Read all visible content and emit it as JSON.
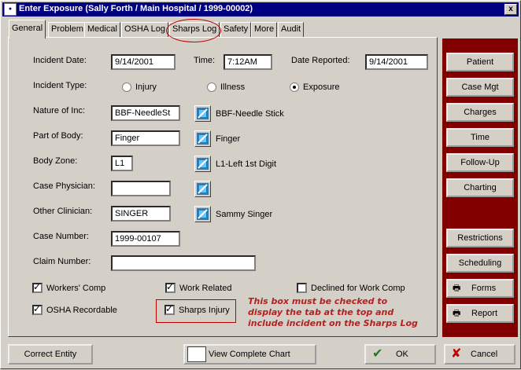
{
  "window": {
    "title": "Enter Exposure (Sally Forth / Main Hospital / 1999-00002)",
    "app_icon": "app-icon",
    "close_label": "x"
  },
  "tabs": [
    {
      "label": "General",
      "active": true
    },
    {
      "label": "Problem"
    },
    {
      "label": "Medical"
    },
    {
      "label": "OSHA Log"
    },
    {
      "label": "Sharps Log"
    },
    {
      "label": "Safety"
    },
    {
      "label": "More"
    },
    {
      "label": "Audit"
    }
  ],
  "form": {
    "incident_date": {
      "label": "Incident Date:",
      "value": "9/14/2001"
    },
    "time": {
      "label": "Time:",
      "value": "7:12AM"
    },
    "date_reported": {
      "label": "Date Reported:",
      "value": "9/14/2001"
    },
    "incident_type": {
      "label": "Incident Type:",
      "options": [
        {
          "label": "Injury",
          "selected": false
        },
        {
          "label": "Illness",
          "selected": false
        },
        {
          "label": "Exposure",
          "selected": true
        }
      ]
    },
    "nature_of_inc": {
      "label": "Nature of Inc:",
      "value": "BBF-NeedleSt",
      "description": "BBF-Needle Stick"
    },
    "part_of_body": {
      "label": "Part of Body:",
      "value": "Finger",
      "description": "Finger"
    },
    "body_zone": {
      "label": "Body Zone:",
      "value": "L1",
      "description": "L1-Left 1st Digit"
    },
    "case_physician": {
      "label": "Case Physician:",
      "value": "",
      "description": ""
    },
    "other_clinician": {
      "label": "Other Clinician:",
      "value": "SINGER",
      "description": "Sammy Singer"
    },
    "case_number": {
      "label": "Case Number:",
      "value": "1999-00107"
    },
    "claim_number": {
      "label": "Claim Number:",
      "value": ""
    },
    "checkboxes": {
      "workers_comp": {
        "label": "Workers' Comp",
        "checked": true
      },
      "work_related": {
        "label": "Work Related",
        "checked": true
      },
      "declined": {
        "label": "Declined for Work Comp",
        "checked": false
      },
      "osha_recordable": {
        "label": "OSHA Recordable",
        "checked": true
      },
      "sharps_injury": {
        "label": "Sharps Injury",
        "checked": true
      }
    }
  },
  "annotation": {
    "line1": "This box must be checked to",
    "line2": "display the tab at the top and",
    "line3": "include incident on the Sharps Log",
    "color": "#b22222"
  },
  "side_buttons": [
    {
      "label": "Patient"
    },
    {
      "label": "Case Mgt"
    },
    {
      "label": "Charges"
    },
    {
      "label": "Time"
    },
    {
      "label": "Follow-Up"
    },
    {
      "label": "Charting"
    },
    {
      "label": "Restrictions"
    },
    {
      "label": "Scheduling"
    },
    {
      "label": "Forms"
    },
    {
      "label": "Report"
    }
  ],
  "bottom": {
    "correct_entity": "Correct Entity",
    "view_complete_chart": "View Complete Chart",
    "ok": "OK",
    "cancel": "Cancel"
  },
  "colors": {
    "title_bar": "#000080",
    "side_panel": "#800000",
    "face": "#d4d0c8"
  }
}
